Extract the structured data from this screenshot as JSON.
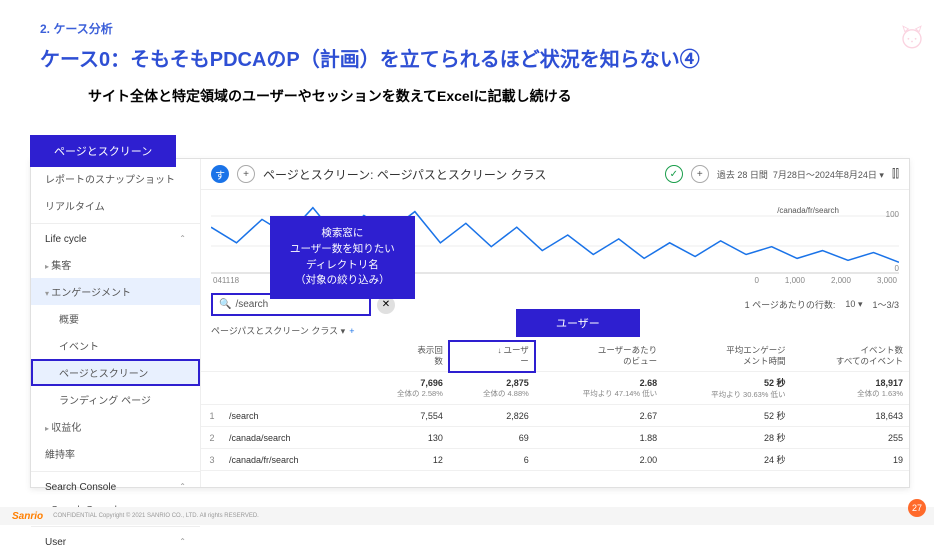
{
  "breadcrumb": "2. ケース分析",
  "title": "ケース0：そもそもPDCAのP（計画）を立てられるほど状況を知らない④",
  "subtitle": "サイト全体と特定領域のユーザーやセッションを数えてExcelに記載し続ける",
  "callouts": {
    "top": "ページとスクリーン",
    "search": "検索窓に\nユーザー数を知りたい\nディレクトリ名\n（対象の絞り込み）",
    "user": "ユーザー"
  },
  "sidebar": {
    "items": [
      {
        "label": "レポートのスナップショット",
        "type": "item"
      },
      {
        "label": "リアルタイム",
        "type": "item"
      },
      {
        "label": "Life cycle",
        "type": "head"
      },
      {
        "label": "集客",
        "type": "collapsed"
      },
      {
        "label": "エンゲージメント",
        "type": "expanded"
      },
      {
        "label": "概要",
        "type": "sub"
      },
      {
        "label": "イベント",
        "type": "sub"
      },
      {
        "label": "ページとスクリーン",
        "type": "sub",
        "selected": true,
        "hl": true
      },
      {
        "label": "ランディング ページ",
        "type": "sub"
      },
      {
        "label": "収益化",
        "type": "collapsed"
      },
      {
        "label": "維持率",
        "type": "item"
      },
      {
        "label": "Search Console",
        "type": "head"
      },
      {
        "label": "Search Console",
        "type": "collapsed"
      },
      {
        "label": "User",
        "type": "head"
      }
    ]
  },
  "topbar": {
    "icon1": "す",
    "icon2": "+",
    "title": "ページとスクリーン: ページパスとスクリーン クラス",
    "date_prefix": "過去 28 日間",
    "date_range": "7月28日〜2024年8月24日"
  },
  "chart_data": {
    "type": "line",
    "series_label": "/canada/fr/search",
    "yticks": [
      0,
      100
    ],
    "xticks": [
      "04",
      "11",
      "18"
    ],
    "axis_right": [
      "0",
      "1,000",
      "2,000",
      "3,000"
    ],
    "values": [
      120,
      80,
      140,
      100,
      170,
      90,
      150,
      110,
      160,
      80,
      130,
      70,
      120,
      60,
      100,
      50,
      90,
      40,
      80,
      45,
      85,
      50,
      70,
      40,
      60,
      35,
      55,
      30
    ]
  },
  "search": {
    "value": "/search",
    "icon": "🔍"
  },
  "pager": {
    "rows_label": "1 ページあたりの行数:",
    "rows": "10",
    "range": "1〜3/3"
  },
  "dimension": {
    "label": "ページパスとスクリーン クラス",
    "plus": "+"
  },
  "columns": {
    "views": {
      "l1": "表示回",
      "l2": "数"
    },
    "users": {
      "arrow": "↓",
      "l1": "ユーザ",
      "l2": "ー"
    },
    "vpu": {
      "l1": "ユーザーあたり",
      "l2": "のビュー"
    },
    "engtime": {
      "l1": "平均エンゲージ",
      "l2": "メント時間"
    },
    "events": {
      "l1": "イベント数",
      "l2": "すべてのイベント"
    }
  },
  "totals": {
    "views": {
      "v": "7,696",
      "s": "全体の 2.58%"
    },
    "users": {
      "v": "2,875",
      "s": "全体の 4.88%"
    },
    "vpu": {
      "v": "2.68",
      "s": "平均より 47.14% 低い"
    },
    "engtime": {
      "v": "52 秒",
      "s": "平均より 30.63% 低い"
    },
    "events": {
      "v": "18,917",
      "s": "全体の 1.63%"
    }
  },
  "rows": [
    {
      "i": "1",
      "path": "/search",
      "views": "7,554",
      "users": "2,826",
      "vpu": "2.67",
      "engtime": "52 秒",
      "events": "18,643"
    },
    {
      "i": "2",
      "path": "/canada/search",
      "views": "130",
      "users": "69",
      "vpu": "1.88",
      "engtime": "28 秒",
      "events": "255"
    },
    {
      "i": "3",
      "path": "/canada/fr/search",
      "views": "12",
      "users": "6",
      "vpu": "2.00",
      "engtime": "24 秒",
      "events": "19"
    }
  ],
  "footer": {
    "brand": "Sanrio",
    "copy": "CONFIDENTIAL Copyright © 2021 SANRIO CO., LTD. All rights RESERVED."
  },
  "pagenum": "27"
}
